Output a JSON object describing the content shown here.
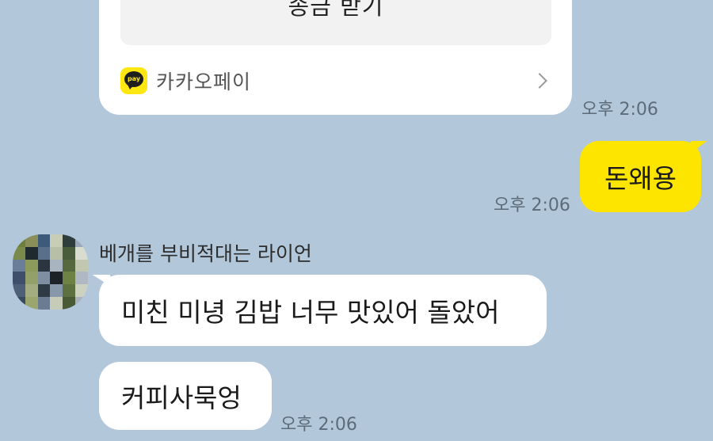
{
  "colors": {
    "background": "#b2c7da",
    "my_bubble": "#fee500",
    "their_bubble": "#ffffff",
    "pay_logo": "#ffe812"
  },
  "pay_card": {
    "button_label": "송금 받기",
    "logo_text": "pay",
    "service_name": "카카오페이",
    "time": "오후 2:06",
    "icon": "chevron-right-icon"
  },
  "my_message": {
    "text": "돈왜용",
    "time": "오후 2:06"
  },
  "incoming": {
    "sender_name": "베개를 부비적대는 라이언",
    "avatar_icon": "pixelated-avatar",
    "messages": [
      {
        "text": "미친 미녕 김밥 너무 맛있어 돌았어"
      },
      {
        "text": "커피사묵엉"
      }
    ],
    "time": "오후 2:06"
  }
}
